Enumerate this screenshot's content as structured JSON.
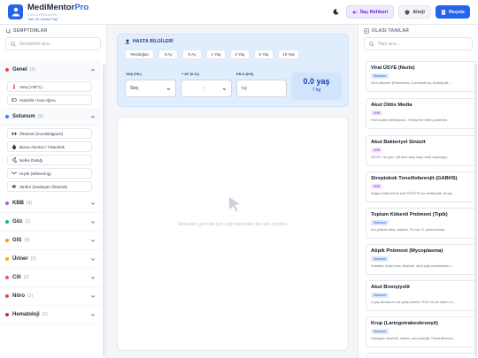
{
  "header": {
    "brand_main": "MediMentor",
    "brand_accent": "Pro",
    "subtitle": "V16.0 PEDIATRI",
    "author": "\"Art. Dr. Ahmet Tay\"",
    "buttons": {
      "drug_guide": "İlaç Rehberi",
      "allergy": "Alerji",
      "prescription": "Reçete"
    }
  },
  "left": {
    "section_title": "SEMPTOMLAR",
    "search_placeholder": "Semptom ara...",
    "categories": [
      {
        "name": "Genel",
        "count": "(2)",
        "color": "#ef4444"
      },
      {
        "name": "Solunum",
        "count": "(5)",
        "color": "#3b82f6"
      },
      {
        "name": "KBB",
        "count": "(4)",
        "color": "#a855f7"
      },
      {
        "name": "Göz",
        "count": "(1)",
        "color": "#10b981"
      },
      {
        "name": "GIS",
        "count": "(4)",
        "color": "#f59e0b"
      },
      {
        "name": "Üriner",
        "count": "(2)",
        "color": "#eab308"
      },
      {
        "name": "Cilt",
        "count": "(3)",
        "color": "#ec4899"
      },
      {
        "name": "Nöro",
        "count": "(1)",
        "color": "#ef4444"
      },
      {
        "name": "Hematoloji",
        "count": "(1)",
        "color": "#dc2626"
      }
    ],
    "genel_symptoms": [
      "Ateş (>38°C)",
      "Halsizlik / Kas Ağrısı"
    ],
    "solunum_symptoms": [
      "Öksürük (Kuru/Balgamlı)",
      "Burun Akıntısı / Tıkanıklık",
      "Nefes Darlığı",
      "Hışıltı (Wheezing)",
      "Stridor (Havlayan Öksürük)"
    ]
  },
  "patient": {
    "title": "HASTA BİLGİLERİ",
    "age_buttons": [
      "Yenidoğan",
      "3 Ay",
      "6 Ay",
      "1 Yaş",
      "2 Yaş",
      "5 Yaş",
      "10 Yaş"
    ],
    "labels": {
      "years": "YAŞ (YIL)",
      "months": "+ AY (0-11)",
      "weight": "KİLO (KG)"
    },
    "year_value": "Seç",
    "month_value": "-",
    "weight_placeholder": "kg",
    "result_age": "0.0 yaş",
    "result_weight": "7 kg"
  },
  "detail": {
    "placeholder": "Detayları görmek için sağ menüden bir tanı seçiniz."
  },
  "right": {
    "section_title": "OLASI TANILAR",
    "search_placeholder": "Tanı ara...",
    "diagnoses": [
      {
        "title": "Viral ÜSYE (Nezle)",
        "badge": "Solunum",
        "desc": "Viral etkenler (Rhinovirus, Coronavirus). Antibiyotik..."
      },
      {
        "title": "Akut Otitis Media",
        "badge": "KBB",
        "desc": "Orta kulak enfeksiyonu. Türkiye'de direnç paternle..."
      },
      {
        "title": "Akut Bakteriyel Sinüzit",
        "badge": "KBB",
        "desc": "ÜSYE >10 gün, çift faza ateş veya ciddi başlangıç..."
      },
      {
        "title": "Streptokok Tonsillofarenjit (GABHS)",
        "badge": "KBB",
        "desc": "Boğaz kültürü/hızlı test POZİTİF ise antibiyotik. Amaç..."
      },
      {
        "title": "Toplum Kökenli Pnömoni (Tipik)",
        "badge": "Solunum",
        "desc": "Ani yüksek ateş, takipne. En sık: S. pneumoniae."
      },
      {
        "title": "Atipik Pnömoni (Mycoplasma)",
        "badge": "Solunum",
        "desc": "Subakut, inatçı kuru öksürük, okul çağı çocuklarda s..."
      },
      {
        "title": "Akut Bronşiyolit",
        "badge": "Solunum",
        "desc": "2 yaş altında en sık yatış sebebi. RSV en sık etken. A..."
      },
      {
        "title": "Krup (Laringotrakeobronşit)",
        "badge": "Solunum",
        "desc": "Havlayan öksürük, stridor, ses kısıklığı. Parainfluenza..."
      }
    ]
  }
}
